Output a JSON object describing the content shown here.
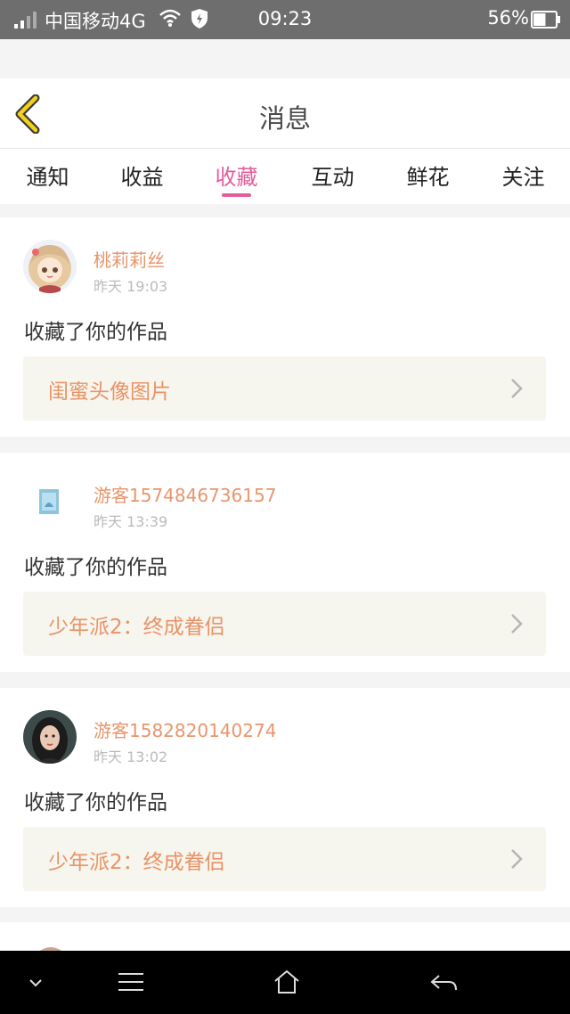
{
  "status_bar": {
    "carrier": "中国移动4G",
    "time": "09:23",
    "battery": "56%",
    "battery_level": 0.56,
    "icons": [
      "signal-icon",
      "wifi-icon",
      "shield-icon",
      "battery-icon"
    ]
  },
  "header": {
    "title": "消息",
    "back_icon": "chevron-left-icon"
  },
  "tabs": [
    {
      "label": "通知",
      "active": false
    },
    {
      "label": "收益",
      "active": false
    },
    {
      "label": "收藏",
      "active": true
    },
    {
      "label": "互动",
      "active": false
    },
    {
      "label": "鲜花",
      "active": false
    },
    {
      "label": "关注",
      "active": false
    }
  ],
  "colors": {
    "accent": "#e35d9b",
    "username": "#e8956b",
    "work_title": "#ea9366",
    "link_bg": "#f6f5ee"
  },
  "messages": [
    {
      "user": "桃莉莉丝",
      "time": "昨天 19:03",
      "action": "收藏了你的作品",
      "work": "闺蜜头像图片",
      "avatar": "anime-girl-avatar"
    },
    {
      "user": "游客1574846736157",
      "time": "昨天 13:39",
      "action": "收藏了你的作品",
      "work": "少年派2：终成眷侣",
      "avatar": "small-blue-picture-avatar"
    },
    {
      "user": "游客1582820140274",
      "time": "昨天 13:02",
      "action": "收藏了你的作品",
      "work": "少年派2：终成眷侣",
      "avatar": "photo-girl-avatar"
    }
  ],
  "nav_bar": {
    "icons": [
      "collapse-icon",
      "menu-icon",
      "home-icon",
      "back-icon"
    ]
  }
}
